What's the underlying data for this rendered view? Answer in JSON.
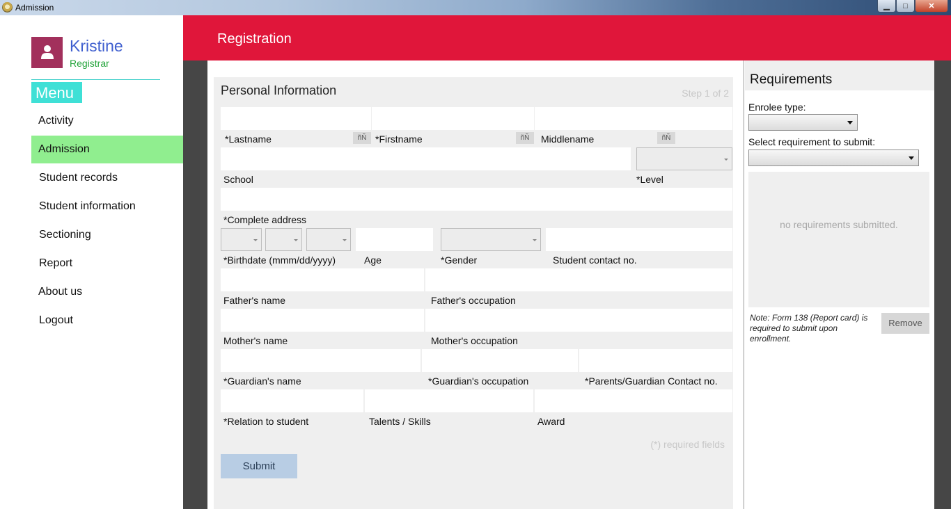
{
  "window": {
    "title": "Admission",
    "minimize": "▁",
    "maximize": "□",
    "close": "✕"
  },
  "colors": {
    "header": "#e0163a",
    "active_menu": "#90ee8f",
    "menu_title_bg": "#3fe0d6",
    "avatar": "#a2305c",
    "user_name": "#3f5fcf",
    "user_role": "#22a33a"
  },
  "user": {
    "name": "Kristine",
    "role": "Registrar",
    "icon": "user-icon"
  },
  "menu": {
    "title": "Menu",
    "items": [
      {
        "label": "Activity"
      },
      {
        "label": "Admission",
        "active": true
      },
      {
        "label": "Student records"
      },
      {
        "label": "Student information"
      },
      {
        "label": "Sectioning"
      },
      {
        "label": "Report"
      },
      {
        "label": "About us"
      },
      {
        "label": "Logout"
      }
    ]
  },
  "header": {
    "title": "Registration"
  },
  "form": {
    "heading": "Personal Information",
    "step": "Step 1 of 2",
    "keyboard_button": "ñÑ",
    "labels": {
      "lastname": "*Lastname",
      "firstname": "*Firstname",
      "middlename": "Middlename",
      "school": "School",
      "level": "*Level",
      "address": "*Complete address",
      "birthdate": "*Birthdate (mmm/dd/yyyy)",
      "age": "Age",
      "gender": "*Gender",
      "contact": "Student contact no.",
      "father_name": "Father's name",
      "father_occupation": "Father's occupation",
      "mother_name": "Mother's name",
      "mother_occupation": "Mother's occupation",
      "guardian_name": "*Guardian's name",
      "guardian_occupation": "*Guardian's occupation",
      "guardian_contact": "*Parents/Guardian Contact no.",
      "relation": "*Relation to student",
      "talents": "Talents / Skills",
      "award": "Award"
    },
    "required_note": "(*) required fields",
    "submit": "Submit"
  },
  "requirements": {
    "title": "Requirements",
    "enrolee_label": "Enrolee type:",
    "select_label": "Select requirement to submit:",
    "empty": "no requirements submitted.",
    "note": "Note: Form 138 (Report card) is required to submit upon enrollment.",
    "remove": "Remove"
  }
}
